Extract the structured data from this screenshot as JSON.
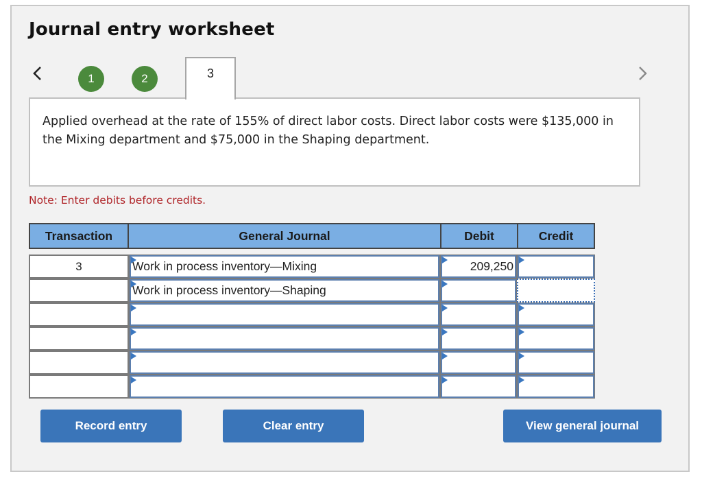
{
  "title": "Journal entry worksheet",
  "navigation": {
    "prev_icon": "chevron-left-icon",
    "next_icon": "chevron-right-icon",
    "steps": [
      {
        "label": "1",
        "state": "completed"
      },
      {
        "label": "2",
        "state": "completed"
      },
      {
        "label": "3",
        "state": "current"
      }
    ],
    "completed_color": "#4b8a3c"
  },
  "question": {
    "text": "Applied overhead at the rate of 155% of direct labor costs. Direct labor costs were $135,000 in the Mixing department and $75,000 in the Shaping department."
  },
  "note": "Note: Enter debits before credits.",
  "journal_table": {
    "columns": [
      "Transaction",
      "General Journal",
      "Debit",
      "Credit"
    ],
    "header_color": "#7aaee3",
    "rows": [
      {
        "transaction": "3",
        "account": "Work in process inventory—Mixing",
        "debit": "209,250",
        "credit": ""
      },
      {
        "transaction": "",
        "account": "Work in process inventory—Shaping",
        "debit": "",
        "credit": ""
      },
      {
        "transaction": "",
        "account": "",
        "debit": "",
        "credit": ""
      },
      {
        "transaction": "",
        "account": "",
        "debit": "",
        "credit": ""
      },
      {
        "transaction": "",
        "account": "",
        "debit": "",
        "credit": ""
      },
      {
        "transaction": "",
        "account": "",
        "debit": "",
        "credit": ""
      }
    ]
  },
  "buttons": {
    "record_entry": "Record entry",
    "clear_entry": "Clear entry",
    "view_general_journal": "View general journal",
    "color": "#3a75b9"
  }
}
